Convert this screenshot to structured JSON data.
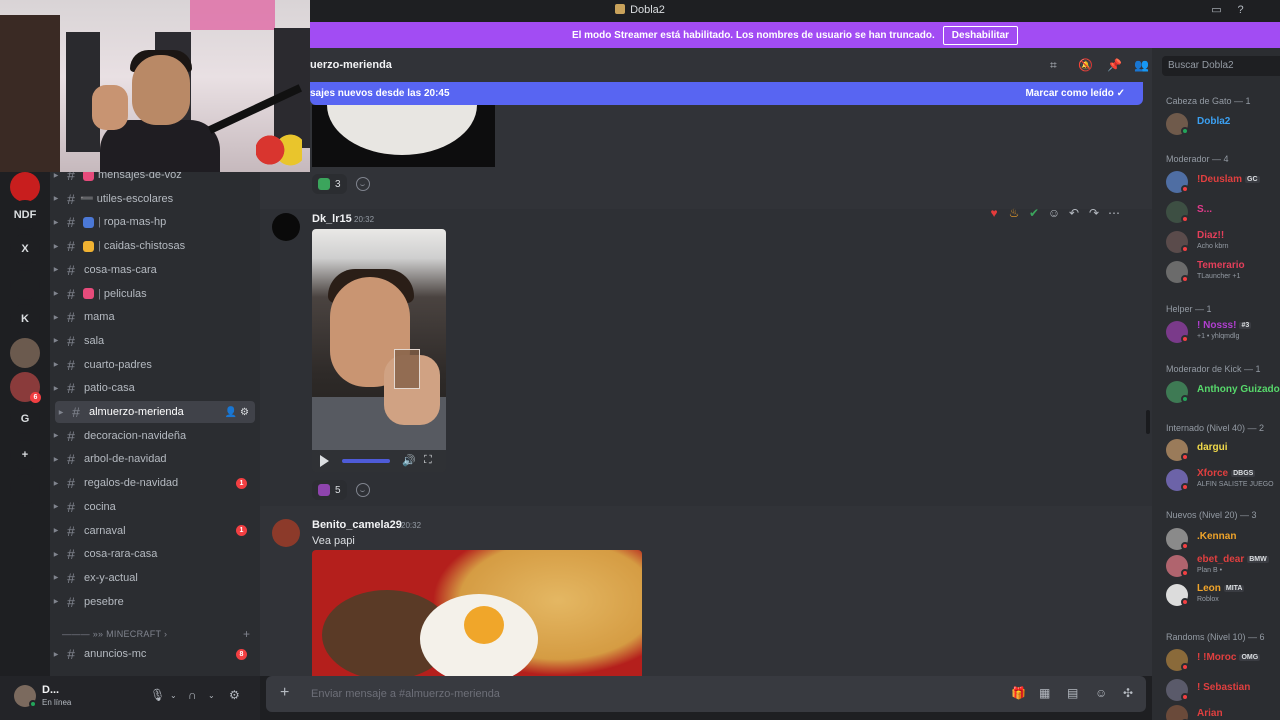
{
  "window": {
    "title": "Dobla2"
  },
  "streamer_banner": {
    "text": "El modo Streamer está habilitado. Los nombres de usuario se han truncado.",
    "button": "Deshabilitar"
  },
  "guild_rail": {
    "items": [
      {
        "label": "",
        "icon": "spiderman-icon",
        "color": "#c81e1e"
      },
      {
        "label": "NDF",
        "color": "#1e1f22"
      },
      {
        "label": "X",
        "color": "#1e1f22"
      },
      {
        "label": "",
        "icon": "folder-icon",
        "color": "#1e1f22"
      },
      {
        "label": "K",
        "color": "#1e1f22"
      },
      {
        "label": "",
        "icon": "server-avatar",
        "color": "#6b5a4e"
      },
      {
        "label": "",
        "icon": "server-avatar-2",
        "color": "#8a3b3b",
        "badge": "6"
      },
      {
        "label": "G",
        "color": "#1e1f22"
      },
      {
        "label": "+",
        "icon": "add-server-icon",
        "color": "#1e1f22"
      },
      {
        "label": "",
        "icon": "explore-icon",
        "color": "#1e1f22"
      }
    ]
  },
  "channels": [
    {
      "name": "mensajes-de-voz",
      "emoji": "#e64b7b",
      "partial": true
    },
    {
      "name": "utiles-escolares",
      "bar": "➖",
      "prefix": true
    },
    {
      "name": "ropa-mas-hp",
      "emoji": "#4b78d6",
      "prefix": true
    },
    {
      "name": "caidas-chistosas",
      "emoji": "#f0b232",
      "prefix": true
    },
    {
      "name": "cosa-mas-cara"
    },
    {
      "name": "peliculas",
      "emoji": "#e64b7b",
      "prefix": true
    },
    {
      "name": "mama"
    },
    {
      "name": "sala"
    },
    {
      "name": "cuarto-padres"
    },
    {
      "name": "patio-casa"
    },
    {
      "name": "almuerzo-merienda",
      "active": true
    },
    {
      "name": "decoracion-navideña"
    },
    {
      "name": "arbol-de-navidad"
    },
    {
      "name": "regalos-de-navidad",
      "unread": "1"
    },
    {
      "name": "cocina"
    },
    {
      "name": "carnaval",
      "unread": "1"
    },
    {
      "name": "cosa-rara-casa"
    },
    {
      "name": "ex-y-actual"
    },
    {
      "name": "pesebre"
    }
  ],
  "category_minecraft": "——— »» MINECRAFT ›",
  "channel_anuncios": {
    "name": "anuncios-mc",
    "unread": "8"
  },
  "user_panel": {
    "name": "D...",
    "status": "En línea"
  },
  "chat": {
    "channel_name": "uerzo-merienda",
    "new_messages": {
      "text": "sajes nuevos desde las 20:45",
      "mark_read": "Marcar como leído"
    },
    "reaction_top": {
      "emoji": "check",
      "count": "3"
    },
    "message1": {
      "author": "Dk_lr15",
      "time": "20:32",
      "reaction": {
        "emoji": "eggplant",
        "count": "5"
      }
    },
    "message2": {
      "author": "Benito_camela29",
      "time": "20:32",
      "text": "Vea papi"
    },
    "composer_placeholder": "Enviar mensaje a #almuerzo-merienda"
  },
  "members": {
    "search_placeholder": "Buscar Dobla2",
    "groups": [
      {
        "title": "Cabeza de Gato — 1",
        "members": [
          {
            "name": "Dobla2",
            "color": "#3ba0f2"
          }
        ]
      },
      {
        "title": "Moderador — 4",
        "members": [
          {
            "name": "!Deuslam",
            "color": "#e03f3f",
            "tag": "GC"
          },
          {
            "name": "S...",
            "color": "#e23a8a"
          },
          {
            "name": "Diaz!!",
            "color": "#e43f5a",
            "sub": "Acho kbrn"
          },
          {
            "name": "Temerario",
            "color": "#e43f5a",
            "sub": "TLauncher +1"
          }
        ]
      },
      {
        "title": "Helper — 1",
        "members": [
          {
            "name": "! Nosss!",
            "color": "#b13fd0",
            "sub": "+1 • yhlqmdlg",
            "tag": "#3"
          }
        ]
      },
      {
        "title": "Moderador de Kick — 1",
        "members": [
          {
            "name": "Anthony Guizado",
            "color": "#57d86b"
          }
        ]
      },
      {
        "title": "Internado (Nivel 40) — 2",
        "members": [
          {
            "name": "dargui",
            "color": "#f0d94a"
          },
          {
            "name": "Xforce",
            "color": "#e03f3f",
            "tag": "DBGS",
            "sub": "ALFIN SALISTE JUEGO"
          }
        ]
      },
      {
        "title": "Nuevos (Nivel 20) — 3",
        "members": [
          {
            "name": ".Kennan",
            "color": "#f0a42a"
          },
          {
            "name": "ebet_dear",
            "color": "#e03f3f",
            "tag": "BMW",
            "sub": "Plan B •"
          },
          {
            "name": "Leon",
            "color": "#f0a42a",
            "tag": "MITA",
            "sub": "Roblox"
          }
        ]
      },
      {
        "title": "Randoms (Nivel 10) — 6",
        "members": [
          {
            "name": "! !Moroc",
            "color": "#e03f3f",
            "tag": "OMG"
          },
          {
            "name": "! Sebastian",
            "color": "#e03f3f"
          },
          {
            "name": "Arian",
            "color": "#e03f3f"
          }
        ]
      }
    ]
  },
  "colors": {
    "brand": "#5865f2",
    "streamer_banner": "#a24cf3",
    "danger": "#f23f42",
    "online": "#23a55a"
  }
}
